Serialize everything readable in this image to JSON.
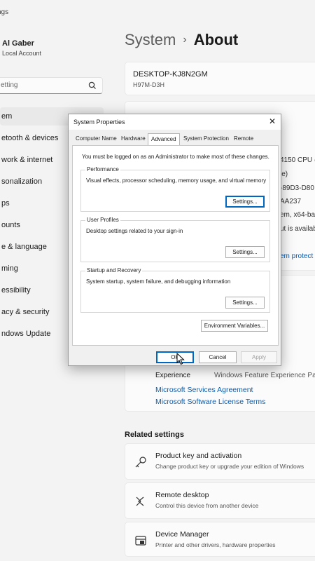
{
  "app": {
    "title": "ngs"
  },
  "profile": {
    "name": "Al Gaber",
    "account_type": "Local Account"
  },
  "search": {
    "placeholder": "etting"
  },
  "sidebar": {
    "items": [
      {
        "label": "em",
        "active": true
      },
      {
        "label": "etooth & devices"
      },
      {
        "label": "work & internet"
      },
      {
        "label": "sonalization"
      },
      {
        "label": "ps"
      },
      {
        "label": "ounts"
      },
      {
        "label": "e & language"
      },
      {
        "label": "ming"
      },
      {
        "label": "essibility"
      },
      {
        "label": "acy & security"
      },
      {
        "label": "ndows Update"
      }
    ]
  },
  "header": {
    "breadcrumb_parent": "System",
    "breadcrumb_separator": "›",
    "breadcrumb_current": "About"
  },
  "device": {
    "name": "DESKTOP-KJ8N2GM",
    "model": "H97M-D3H"
  },
  "specs_visible_fragments": [
    "4150 CPU @",
    "le)",
    "-89D3-D80",
    "AA237",
    "em, x64-ba",
    "ut is availab"
  ],
  "specs_link": "em protect",
  "windows_specs": {
    "label": "Experience",
    "value": "Windows Feature Experience Pa",
    "links": [
      "Microsoft Services Agreement",
      "Microsoft Software License Terms"
    ]
  },
  "related": {
    "title": "Related settings",
    "items": [
      {
        "icon": "key-icon",
        "title": "Product key and activation",
        "subtitle": "Change product key or upgrade your edition of Windows"
      },
      {
        "icon": "remote-desktop-icon",
        "title": "Remote desktop",
        "subtitle": "Control this device from another device"
      },
      {
        "icon": "device-manager-icon",
        "title": "Device Manager",
        "subtitle": "Printer and other drivers, hardware properties"
      }
    ]
  },
  "dialog": {
    "title": "System Properties",
    "tabs": [
      "Computer Name",
      "Hardware",
      "Advanced",
      "System Protection",
      "Remote"
    ],
    "active_tab": "Advanced",
    "notice": "You must be logged on as an Administrator to make most of these changes.",
    "performance": {
      "legend": "Performance",
      "desc": "Visual effects, processor scheduling, memory usage, and virtual memory",
      "button": "Settings..."
    },
    "user_profiles": {
      "legend": "User Profiles",
      "desc": "Desktop settings related to your sign-in",
      "button": "Settings..."
    },
    "startup": {
      "legend": "Startup and Recovery",
      "desc": "System startup, system failure, and debugging information",
      "button": "Settings..."
    },
    "env_button": "Environment Variables...",
    "ok": "OK",
    "cancel": "Cancel",
    "apply": "Apply"
  }
}
